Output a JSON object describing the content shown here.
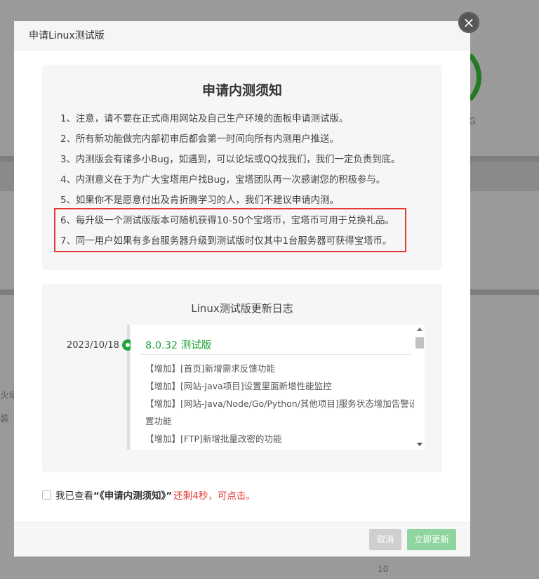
{
  "background": {
    "partial_texts": [
      "G",
      "火墙",
      "装",
      "10"
    ]
  },
  "dialog": {
    "title": "申请Linux测试版",
    "close_icon": "close-icon"
  },
  "notice": {
    "title": "申请内测须知",
    "items": [
      "1、注意，请不要在正式商用网站及自己生产环境的面板申请测试版。",
      "2、所有新功能做完内部初审后都会第一时间向所有内测用户推送。",
      "3、内测版会有诸多小Bug，如遇到，可以论坛或QQ找我们，我们一定负责到底。",
      "4、内测意义在于为广大宝塔用户找Bug，宝塔团队再一次感谢您的积极参与。",
      "5、如果你不是愿意付出及肯折腾学习的人，我们不建议申请内测。",
      "6、每升级一个测试版版本可随机获得10-50个宝塔币，宝塔币可用于兑换礼品。",
      "7、同一用户如果有多台服务器升级到测试版时仅其中1台服务器可获得宝塔币。"
    ],
    "highlight_color": "#e53935"
  },
  "changelog": {
    "title": "Linux测试版更新日志",
    "date": "2023/10/18",
    "version": "8.0.32 测试版",
    "entries": [
      "【增加】[首页]新增需求反馈功能",
      "【增加】[网站-Java项目]设置里面新增性能监控",
      "【增加】[网站-Java/Node/Go/Python/其他项目]服务状态增加告警设",
      "置功能",
      "【增加】[FTP]新增批量改密的功能"
    ],
    "accent_color": "#20a53a"
  },
  "agreement": {
    "prefix": "我已查看",
    "link_text": "“《申请内测须知》”",
    "countdown": "还剩4秒，可点击。"
  },
  "footer": {
    "cancel_label": "取消",
    "update_label": "立即更新"
  }
}
